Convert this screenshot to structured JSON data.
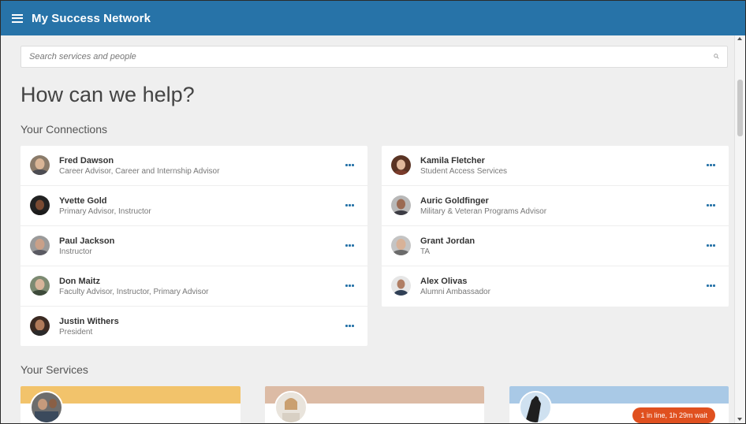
{
  "header": {
    "title": "My Success Network"
  },
  "search": {
    "placeholder": "Search services and people"
  },
  "main": {
    "headline": "How can we help?",
    "connections_title": "Your Connections",
    "services_title": "Your Services"
  },
  "connections": [
    {
      "name": "Fred Dawson",
      "role": "Career Advisor, Career and Internship Advisor"
    },
    {
      "name": "Yvette Gold",
      "role": "Primary Advisor, Instructor"
    },
    {
      "name": "Paul Jackson",
      "role": "Instructor"
    },
    {
      "name": "Don Maitz",
      "role": "Faculty Advisor, Instructor, Primary Advisor"
    },
    {
      "name": "Justin Withers",
      "role": "President"
    },
    {
      "name": "Kamila Fletcher",
      "role": "Student Access Services"
    },
    {
      "name": "Auric Goldfinger",
      "role": "Military & Veteran Programs Advisor"
    },
    {
      "name": "Grant Jordan",
      "role": "TA"
    },
    {
      "name": "Alex Olivas",
      "role": "Alumni Ambassador"
    }
  ],
  "services": [
    {
      "band_color": "#f2c36b"
    },
    {
      "band_color": "#dcbba5"
    },
    {
      "band_color": "#a9c9e6",
      "wait_badge": "1 in line, 1h 29m wait"
    }
  ],
  "colors": {
    "header": "#2773a8",
    "accent": "#2773a8",
    "badge": "#e0501f"
  },
  "icons": {
    "menu": "hamburger-menu-icon",
    "search": "search-icon",
    "more": "more-dots-icon"
  }
}
